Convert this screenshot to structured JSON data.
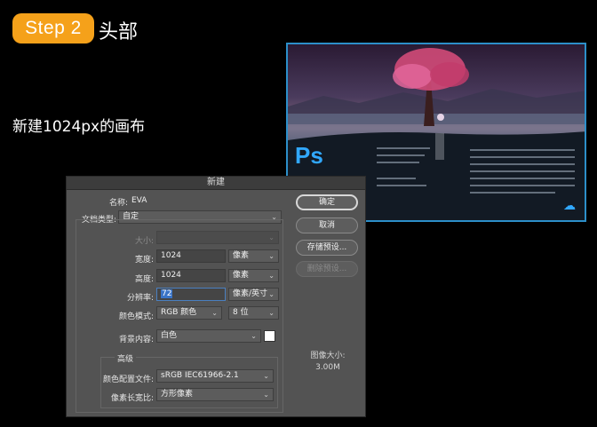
{
  "tutorial": {
    "step_label": "Step 2",
    "step_title": "头部",
    "description": "新建1024px的画布"
  },
  "splash": {
    "logo": "Ps",
    "cc_icon": "creative-cloud-icon"
  },
  "dialog": {
    "title": "新建",
    "name_label": "名称:",
    "name_value": "EVA",
    "preset_label": "文档类型:",
    "preset_value": "自定",
    "size_label": "大小:",
    "width_label": "宽度:",
    "width_value": "1024",
    "width_unit": "像素",
    "height_label": "高度:",
    "height_value": "1024",
    "height_unit": "像素",
    "resolution_label": "分辨率:",
    "resolution_value": "72",
    "resolution_unit": "像素/英寸",
    "color_mode_label": "颜色模式:",
    "color_mode_value": "RGB 颜色",
    "bit_depth_value": "8 位",
    "background_label": "背景内容:",
    "background_value": "白色",
    "background_swatch_color": "#ffffff",
    "advanced_label": "高级",
    "color_profile_label": "颜色配置文件:",
    "color_profile_value": "sRGB IEC61966-2.1",
    "pixel_aspect_label": "像素长宽比:",
    "pixel_aspect_value": "方形像素",
    "buttons": {
      "ok": "确定",
      "cancel": "取消",
      "save_preset": "存储预设...",
      "delete_preset": "删除预设..."
    },
    "image_size_label": "图像大小:",
    "image_size_value": "3.00M"
  },
  "colors": {
    "accent_orange": "#f5a11a",
    "ps_blue": "#31a8ff"
  }
}
